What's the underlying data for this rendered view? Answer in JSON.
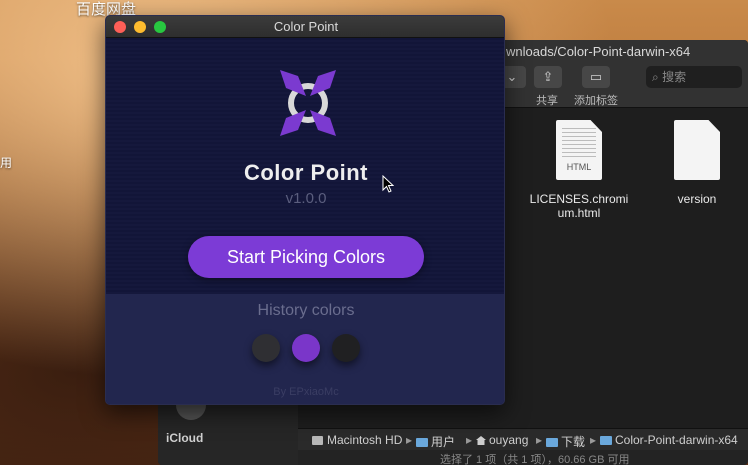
{
  "desktop": {
    "label_top": "百度网盘",
    "label_side": "用"
  },
  "finder": {
    "title_partial": "wnloads/Color-Point-darwin-x64",
    "search_placeholder": "搜索",
    "share_label": "共享",
    "add_tag_label": "添加标签",
    "sidebar_icloud": "iCloud",
    "files": [
      {
        "name_line1": "LICENSES.chromi",
        "name_line2": "um.html",
        "tag": "HTML"
      },
      {
        "name_line1": "version",
        "name_line2": "",
        "tag": ""
      }
    ],
    "pathbar": [
      "Macintosh HD",
      "用户",
      "ouyang",
      "下载",
      "Color-Point-darwin-x64"
    ],
    "path_separator": "▸",
    "status": "选择了 1 项（共 1 项），60.66 GB 可用"
  },
  "app": {
    "window_title": "Color Point",
    "name": "Color Point",
    "version": "v1.0.0",
    "start_button": "Start Picking Colors",
    "history_title": "History colors",
    "footer": "By EPxiaoMc",
    "history_swatches": [
      "#2f2f33",
      "#7a36c9",
      "#202022"
    ],
    "accent_color": "#7c3bd6"
  },
  "icons": {
    "logo": "color-point-logo-icon",
    "share": "share-icon",
    "tag": "tag-icon",
    "search": "search-icon"
  }
}
